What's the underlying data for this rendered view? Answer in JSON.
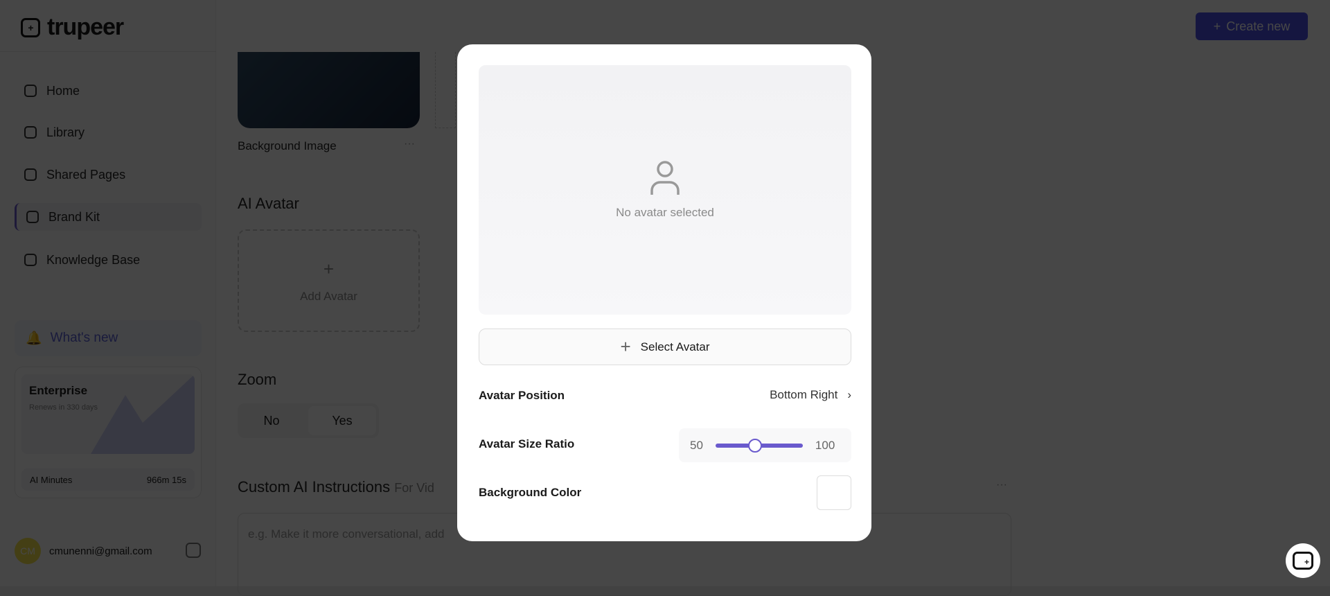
{
  "brand": "trupeer",
  "sidebar": {
    "items": [
      {
        "label": "Home"
      },
      {
        "label": "Library"
      },
      {
        "label": "Shared Pages"
      },
      {
        "label": "Brand Kit",
        "active": true
      },
      {
        "label": "Knowledge Base"
      }
    ],
    "whats_new": "What's new",
    "plan": {
      "name": "Enterprise",
      "renews": "Renews in 330 days",
      "minutes_label": "AI Minutes",
      "minutes_value": "966m 15s"
    },
    "user": {
      "initials": "CM",
      "email": "cmunenni@gmail.com"
    }
  },
  "header": {
    "create_new": "Create new"
  },
  "main": {
    "background_image_label": "Background Image",
    "ai_avatar_heading": "AI Avatar",
    "add_avatar": "Add Avatar",
    "zoom_heading": "Zoom",
    "zoom_options": [
      "No",
      "Yes"
    ],
    "zoom_selected": "Yes",
    "custom_ai_heading": "Custom AI Instructions",
    "custom_ai_sub": "For Vid",
    "custom_ai_placeholder": "e.g. Make it more conversational, add"
  },
  "modal": {
    "empty_text": "No avatar selected",
    "select_avatar": "Select Avatar",
    "position_label": "Avatar Position",
    "position_value": "Bottom Right",
    "size_label": "Avatar Size Ratio",
    "size_min": "50",
    "size_max": "100",
    "size_value_fraction": 0.45,
    "bg_color_label": "Background Color",
    "bg_color": "#ffffff"
  },
  "colors": {
    "accent": "#6a5acd",
    "primary_button": "#4b50e6"
  }
}
